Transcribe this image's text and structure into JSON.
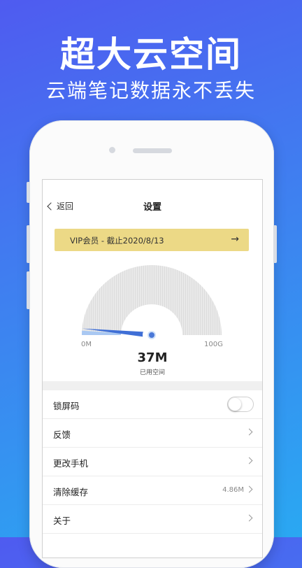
{
  "hero": {
    "title": "超大云空间",
    "subtitle": "云端笔记数据永不丢失"
  },
  "nav": {
    "back_label": "返回",
    "title": "设置"
  },
  "vip": {
    "text": "VIP会员 - 截止2020/8/13",
    "arrow": "→"
  },
  "storage": {
    "min_label": "0M",
    "max_label": "100G",
    "used_value": "37M",
    "used_label": "已用空间",
    "used_fraction": 0.0004,
    "colors": {
      "track": "#e6e6e6",
      "needle": "#3f6fd6",
      "fill": "#a9c8f2"
    }
  },
  "settings": {
    "lock": {
      "label": "锁屏码",
      "enabled": false
    },
    "feedback": {
      "label": "反馈"
    },
    "change_phone": {
      "label": "更改手机"
    },
    "clear_cache": {
      "label": "清除缓存",
      "value": "4.86M"
    },
    "about": {
      "label": "关于"
    }
  }
}
